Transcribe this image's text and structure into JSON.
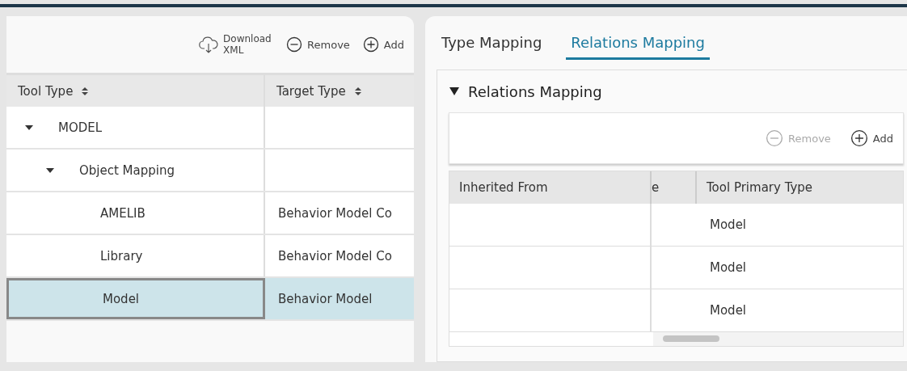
{
  "left_toolbar": {
    "buttons": [
      {
        "kind": "download",
        "label": "Download XML"
      },
      {
        "kind": "remove",
        "label": "Remove",
        "disabled": false
      },
      {
        "kind": "add",
        "label": "Add",
        "disabled": false
      }
    ]
  },
  "tree_table": {
    "columns": [
      "Tool Type",
      "Target Type"
    ],
    "rows": [
      {
        "label": "MODEL",
        "expanded": true,
        "selected": false,
        "children": [
          {
            "label": "Object Mapping",
            "expanded": true,
            "selected": false,
            "children": [
              {
                "label": "AMELIB",
                "target": "Behavior Model Co",
                "selected": false
              },
              {
                "label": "Library",
                "target": "Behavior Model Co",
                "selected": false
              },
              {
                "label": "Model",
                "target": "Behavior Model",
                "selected": true
              }
            ]
          }
        ]
      }
    ]
  },
  "tabs": [
    {
      "label": "Type Mapping",
      "selected": false
    },
    {
      "label": "Relations Mapping",
      "selected": true
    }
  ],
  "section": {
    "title": "Relations Mapping",
    "expanded": true,
    "toolbar": {
      "buttons": [
        {
          "kind": "remove",
          "label": "Remove",
          "disabled": true
        },
        {
          "kind": "add",
          "label": "Add",
          "disabled": false
        }
      ]
    },
    "table": {
      "columns": [
        "Inherited From",
        "e",
        "Tool Primary Type"
      ],
      "rows": [
        {
          "tool_primary_type": "Model"
        },
        {
          "tool_primary_type": "Model"
        },
        {
          "tool_primary_type": "Model"
        }
      ]
    }
  }
}
